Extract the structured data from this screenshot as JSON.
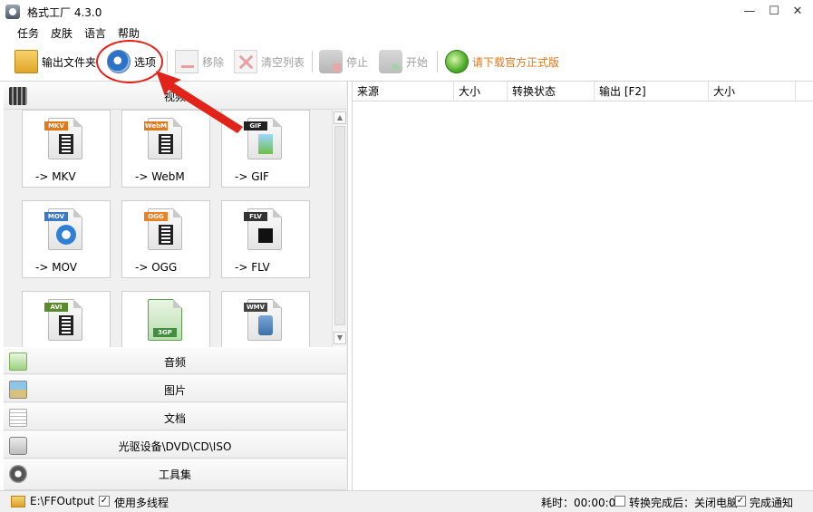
{
  "app": {
    "title": "格式工厂 4.3.0"
  },
  "window_controls": {
    "minimize": "—",
    "maximize": "☐",
    "close": "✕"
  },
  "menu": [
    "任务",
    "皮肤",
    "语言",
    "帮助"
  ],
  "toolbar": {
    "output_folder": "输出文件夹",
    "options": "选项",
    "remove": "移除",
    "clear_list": "清空列表",
    "stop": "停止",
    "start": "开始",
    "download_official": "请下载官方正式版"
  },
  "categories": {
    "video": "视频",
    "audio": "音频",
    "image": "图片",
    "document": "文档",
    "disc": "光驱设备\\DVD\\CD\\ISO",
    "tools": "工具集"
  },
  "formats": [
    {
      "badge": "MKV",
      "label": "-> MKV",
      "badge_color": "#e0781c"
    },
    {
      "badge": "WebM",
      "label": "-> WebM",
      "badge_color": "#e0781c"
    },
    {
      "badge": "GIF",
      "label": "-> GIF",
      "badge_color": "#222222"
    },
    {
      "badge": "MOV",
      "label": "-> MOV",
      "badge_color": "#3b78c8"
    },
    {
      "badge": "OGG",
      "label": "-> OGG",
      "badge_color": "#e8832a"
    },
    {
      "badge": "FLV",
      "label": "-> FLV",
      "badge_color": "#333333"
    },
    {
      "badge": "AVI",
      "label": "",
      "badge_color": "#5b8a2e"
    },
    {
      "badge": "3GP",
      "label": "",
      "badge_color": "#3f8f3f"
    },
    {
      "badge": "WMV",
      "label": "",
      "badge_color": "#444444"
    }
  ],
  "table": {
    "columns": [
      "来源",
      "大小",
      "转换状态",
      "输出 [F2]",
      "大小"
    ]
  },
  "statusbar": {
    "output_path": "E:\\FFOutput",
    "multithread_label": "使用多线程",
    "multithread_checked": "✓",
    "elapsed": "耗时：00:00:00",
    "after_convert_label": "转换完成后：关闭电脑",
    "notify_label": "完成通知",
    "notify_checked": "✓"
  },
  "colors": {
    "annotation": "#e2231a",
    "download_text": "#e0781c"
  }
}
